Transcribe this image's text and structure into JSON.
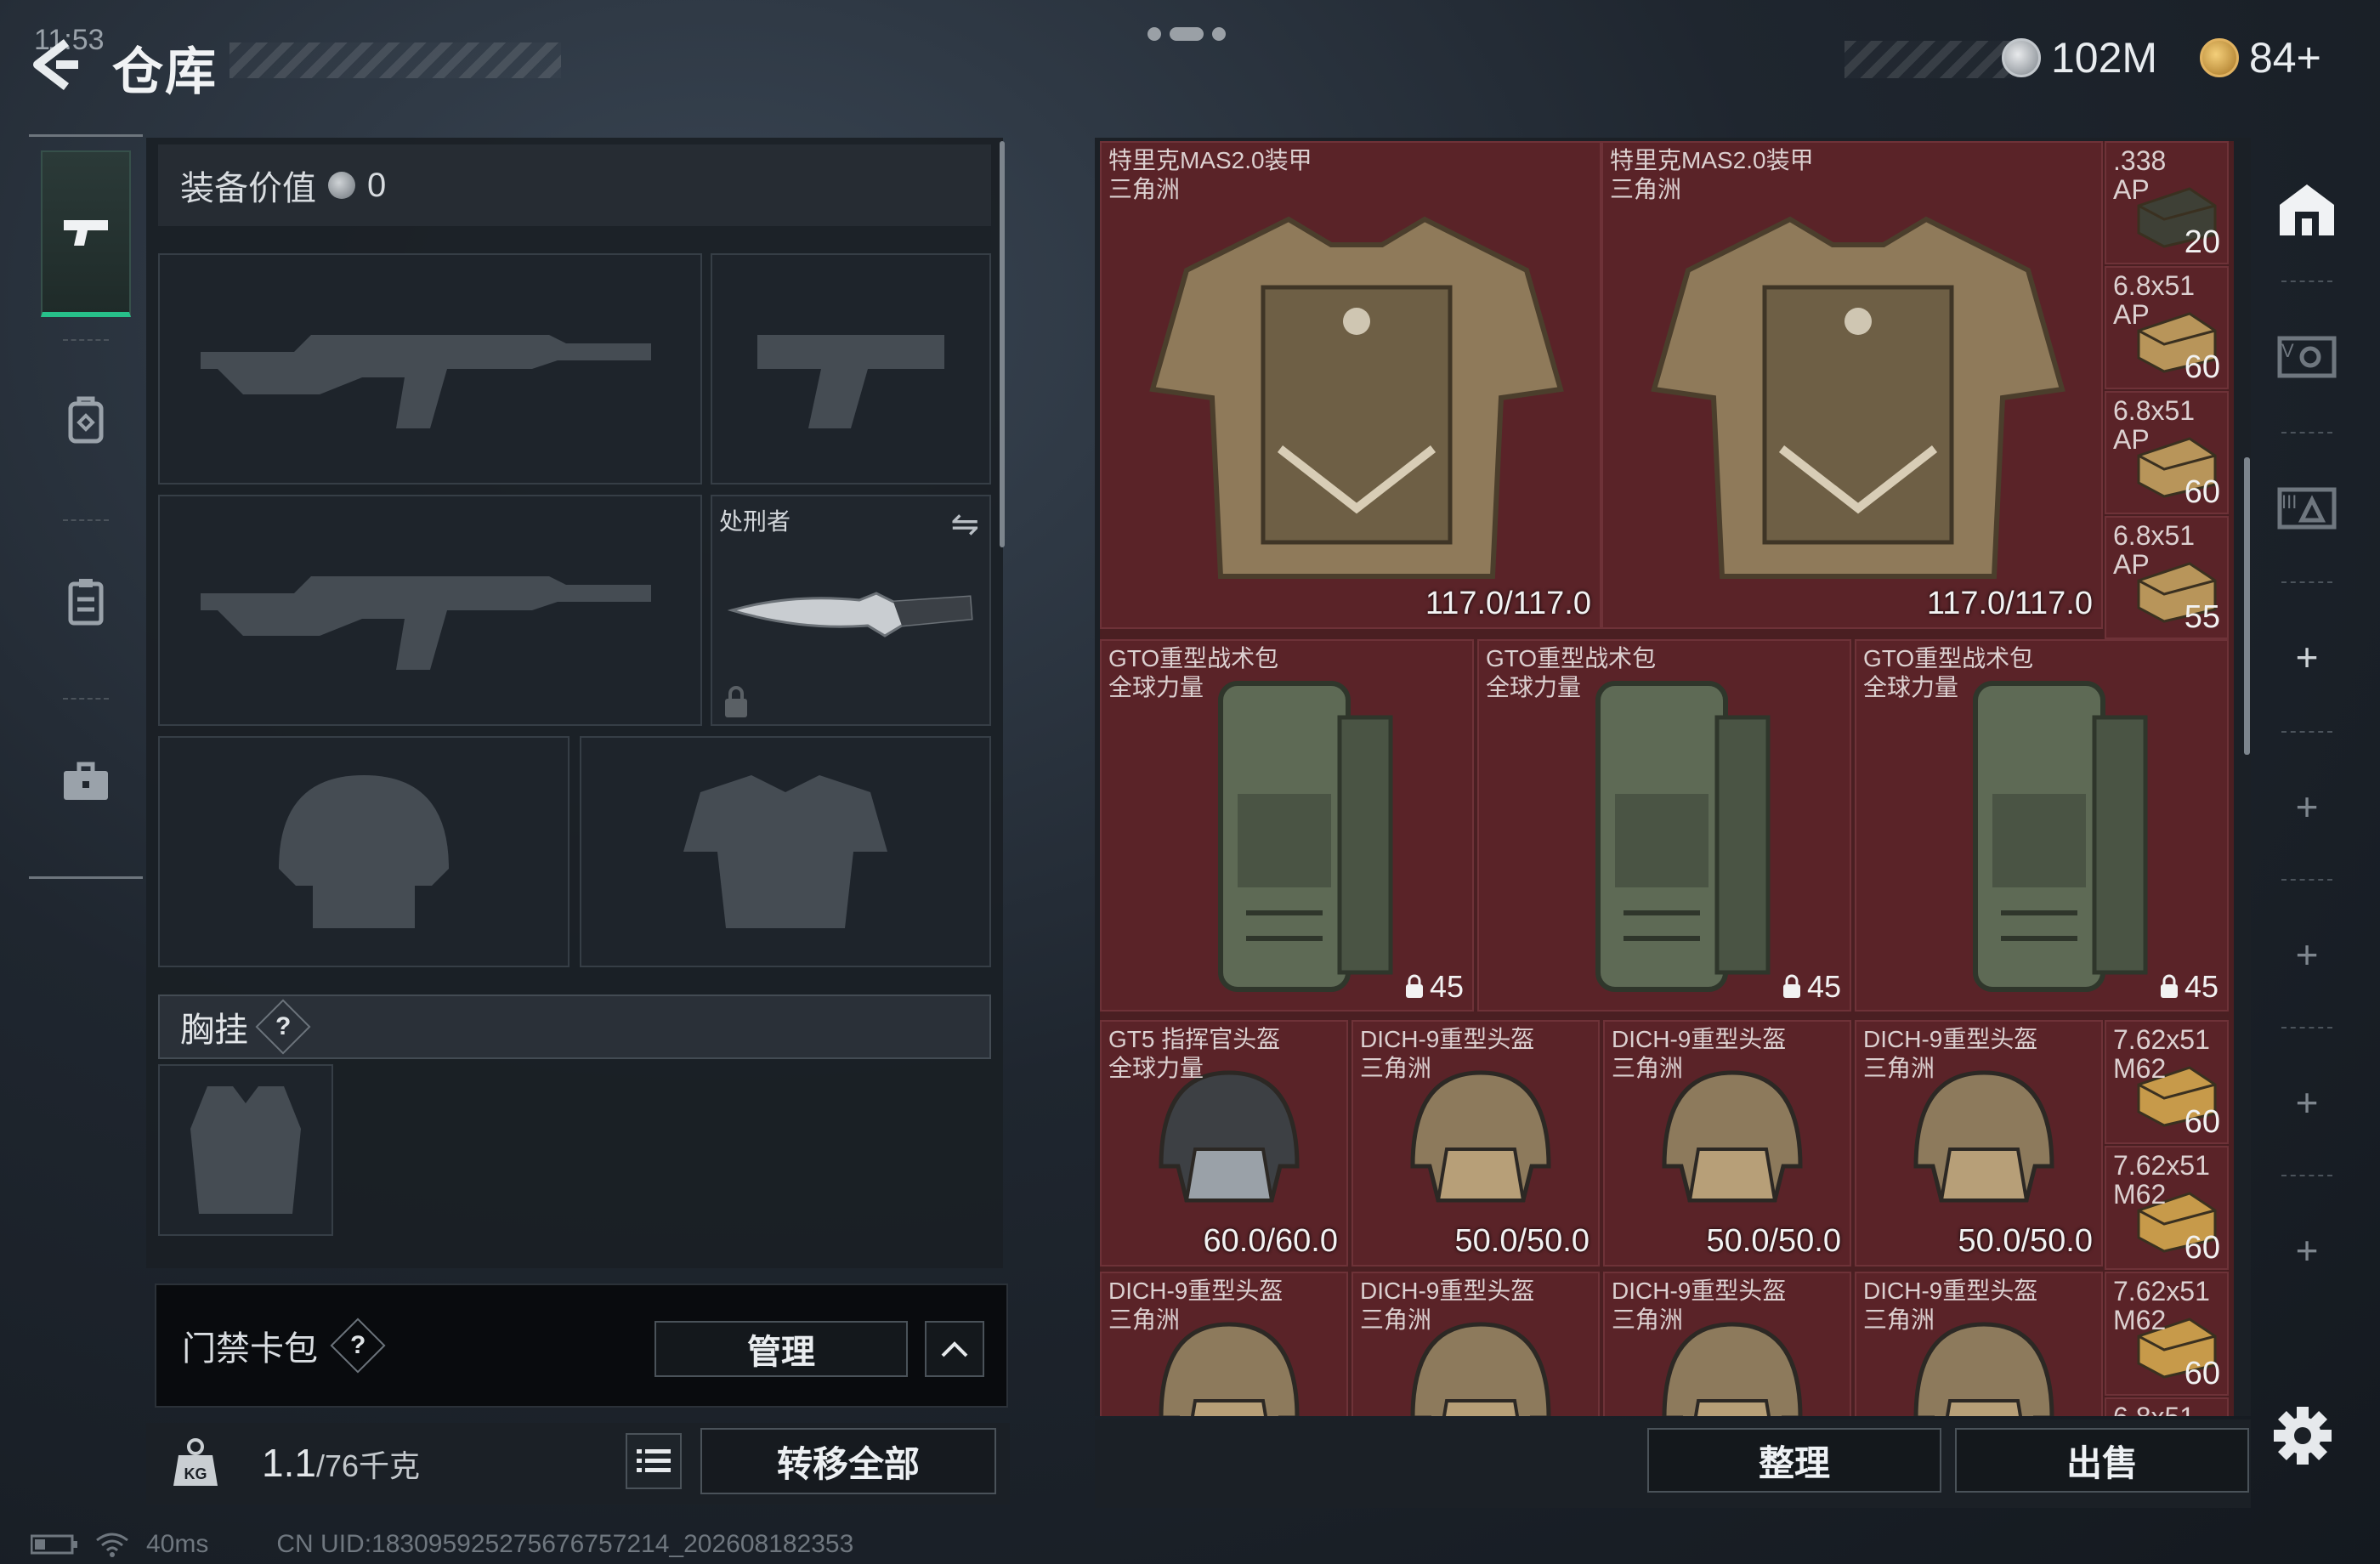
{
  "status": {
    "time": "11:53",
    "ping": "40ms",
    "uid": "CN UID:1830959252756767572​14_202608182353"
  },
  "header": {
    "title": "仓库",
    "currency_silver": "102M",
    "currency_gold": "84+"
  },
  "nav": {
    "items": [
      "weapons",
      "backpack",
      "inventory",
      "toolbox"
    ]
  },
  "loadout": {
    "equipment_value_label": "装备价值",
    "equipment_value": "0",
    "melee_label": "处刑者",
    "chest_rig_label": "胸挂",
    "chest_rig_help": "?",
    "keycard_label": "门禁卡包",
    "keycard_help": "?",
    "manage_label": "管理",
    "weight_current": "1.1",
    "weight_max": "/76千克",
    "transfer_all_label": "转移全部"
  },
  "stash": {
    "armor": [
      {
        "name": "特里克MAS2.0装甲\n三角洲",
        "durability": "117.0/117.0"
      },
      {
        "name": "特里克MAS2.0装甲\n三角洲",
        "durability": "117.0/117.0"
      }
    ],
    "ammo_top": [
      {
        "name": ".338\nAP",
        "count": "20"
      },
      {
        "name": "6.8x51\nAP",
        "count": "60"
      },
      {
        "name": "6.8x51\nAP",
        "count": "60"
      },
      {
        "name": "6.8x51\nAP",
        "count": "55"
      }
    ],
    "backpacks": [
      {
        "name": "GTO重型战术包\n全球力量",
        "capacity": "45"
      },
      {
        "name": "GTO重型战术包\n全球力量",
        "capacity": "45"
      },
      {
        "name": "GTO重型战术包\n全球力量",
        "capacity": "45"
      }
    ],
    "helmets_row1": [
      {
        "name": "GT5 指挥官头盔\n全球力量",
        "durability": "60.0/60.0"
      },
      {
        "name": "DICH-9重型头盔\n三角洲",
        "durability": "50.0/50.0"
      },
      {
        "name": "DICH-9重型头盔\n三角洲",
        "durability": "50.0/50.0"
      },
      {
        "name": "DICH-9重型头盔\n三角洲",
        "durability": "50.0/50.0"
      }
    ],
    "helmets_row2": [
      {
        "name": "DICH-9重型头盔\n三角洲"
      },
      {
        "name": "DICH-9重型头盔\n三角洲"
      },
      {
        "name": "DICH-9重型头盔\n三角洲"
      },
      {
        "name": "DICH-9重型头盔\n三角洲"
      }
    ],
    "ammo_bottom": [
      {
        "name": "7.62x51\nM62",
        "count": "60"
      },
      {
        "name": "7.62x51\nM62",
        "count": "60"
      },
      {
        "name": "7.62x51\nM62",
        "count": "60"
      },
      {
        "name": "6.8x51",
        "count": ""
      }
    ],
    "sort_label": "整理",
    "sell_label": "出售"
  },
  "colors": {
    "accent_green": "#27c08a",
    "stash_bg": "#5a2328"
  }
}
